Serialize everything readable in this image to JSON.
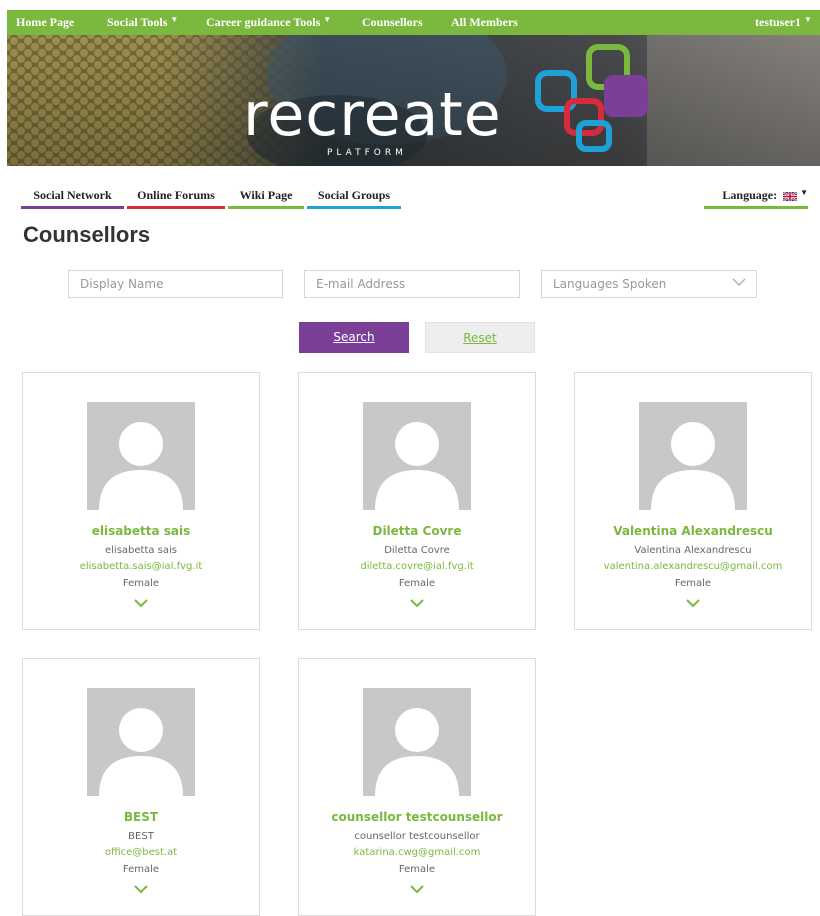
{
  "topnav": {
    "home": "Home Page",
    "social_tools": "Social Tools",
    "career_tools": "Career guidance Tools",
    "counsellors": "Counsellors",
    "all_members": "All Members",
    "user": "testuser1"
  },
  "banner": {
    "logo_text": "recreate",
    "logo_sub": "PLATFORM"
  },
  "secnav": {
    "social_network": "Social Network",
    "online_forums": "Online Forums",
    "wiki_page": "Wiki Page",
    "social_groups": "Social Groups",
    "language_label": "Language:",
    "flag_icon": "uk-flag-icon"
  },
  "page": {
    "title": "Counsellors"
  },
  "search": {
    "display_name_placeholder": "Display Name",
    "email_placeholder": "E-mail Address",
    "languages_placeholder": "Languages Spoken",
    "search_label": "Search",
    "reset_label": "Reset"
  },
  "colors": {
    "green": "#7ab83e",
    "purple": "#7b3f98",
    "red": "#d52b3a",
    "blue": "#1fa0d6"
  },
  "counsellors": [
    {
      "name": "elisabetta sais",
      "display": "elisabetta sais",
      "email": "elisabetta.sais@ial.fvg.it",
      "gender": "Female"
    },
    {
      "name": "Diletta Covre",
      "display": "Diletta Covre",
      "email": "diletta.covre@ial.fvg.it",
      "gender": "Female"
    },
    {
      "name": "Valentina Alexandrescu",
      "display": "Valentina Alexandrescu",
      "email": "valentina.alexandrescu@gmail.com",
      "gender": "Female"
    },
    {
      "name": "BEST",
      "display": "BEST",
      "email": "office@best.at",
      "gender": "Female"
    },
    {
      "name": "counsellor testcounsellor",
      "display": "counsellor testcounsellor",
      "email": "katarina.cwg@gmail.com",
      "gender": "Female"
    }
  ]
}
